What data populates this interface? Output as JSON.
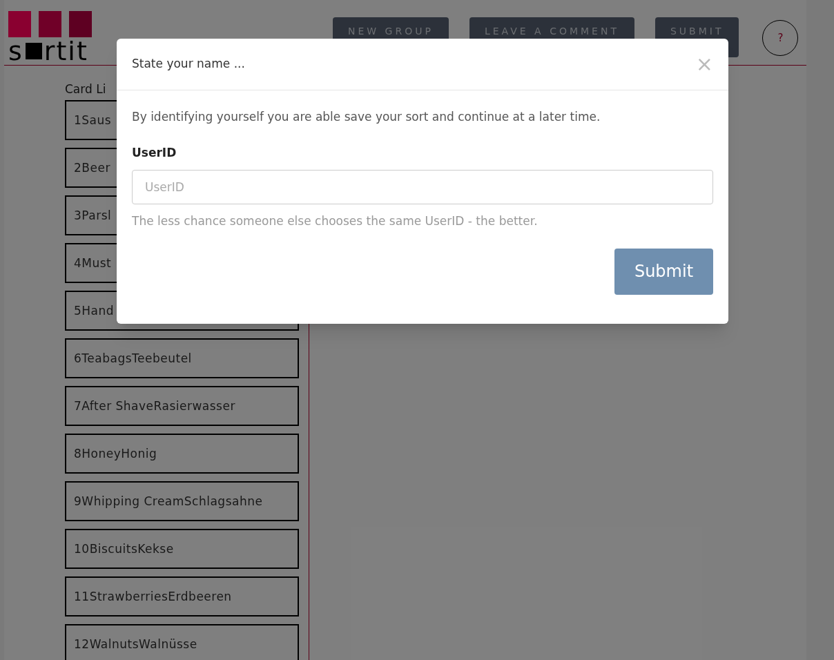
{
  "logo": {
    "before": "s",
    "after": "rtit",
    "squares": [
      {
        "color": "#8a0030"
      },
      {
        "color": "#700028"
      },
      {
        "color": "#5e0022"
      }
    ]
  },
  "header": {
    "buttons": [
      "NEW GROUP",
      "LEAVE A COMMENT",
      "SUBMIT"
    ],
    "help": "?"
  },
  "card_list": {
    "title": "Card Li",
    "cards": [
      "1Saus",
      "2Beer",
      "3Parsl",
      "4Must",
      "5Hand",
      "6TeabagsTeebeutel",
      "7After ShaveRasierwasser",
      "8HoneyHonig",
      "9Whipping CreamSchlagsahne",
      "10BiscuitsKekse",
      "11StrawberriesErdbeeren",
      "12WalnutsWalnüsse"
    ]
  },
  "modal": {
    "title": "State your name ...",
    "close": "×",
    "intro": "By identifying yourself you are able save your sort and continue at a later time.",
    "label": "UserID",
    "placeholder": "UserID",
    "help": "The less chance someone else chooses the same UserID - the better.",
    "submit": "Submit"
  }
}
